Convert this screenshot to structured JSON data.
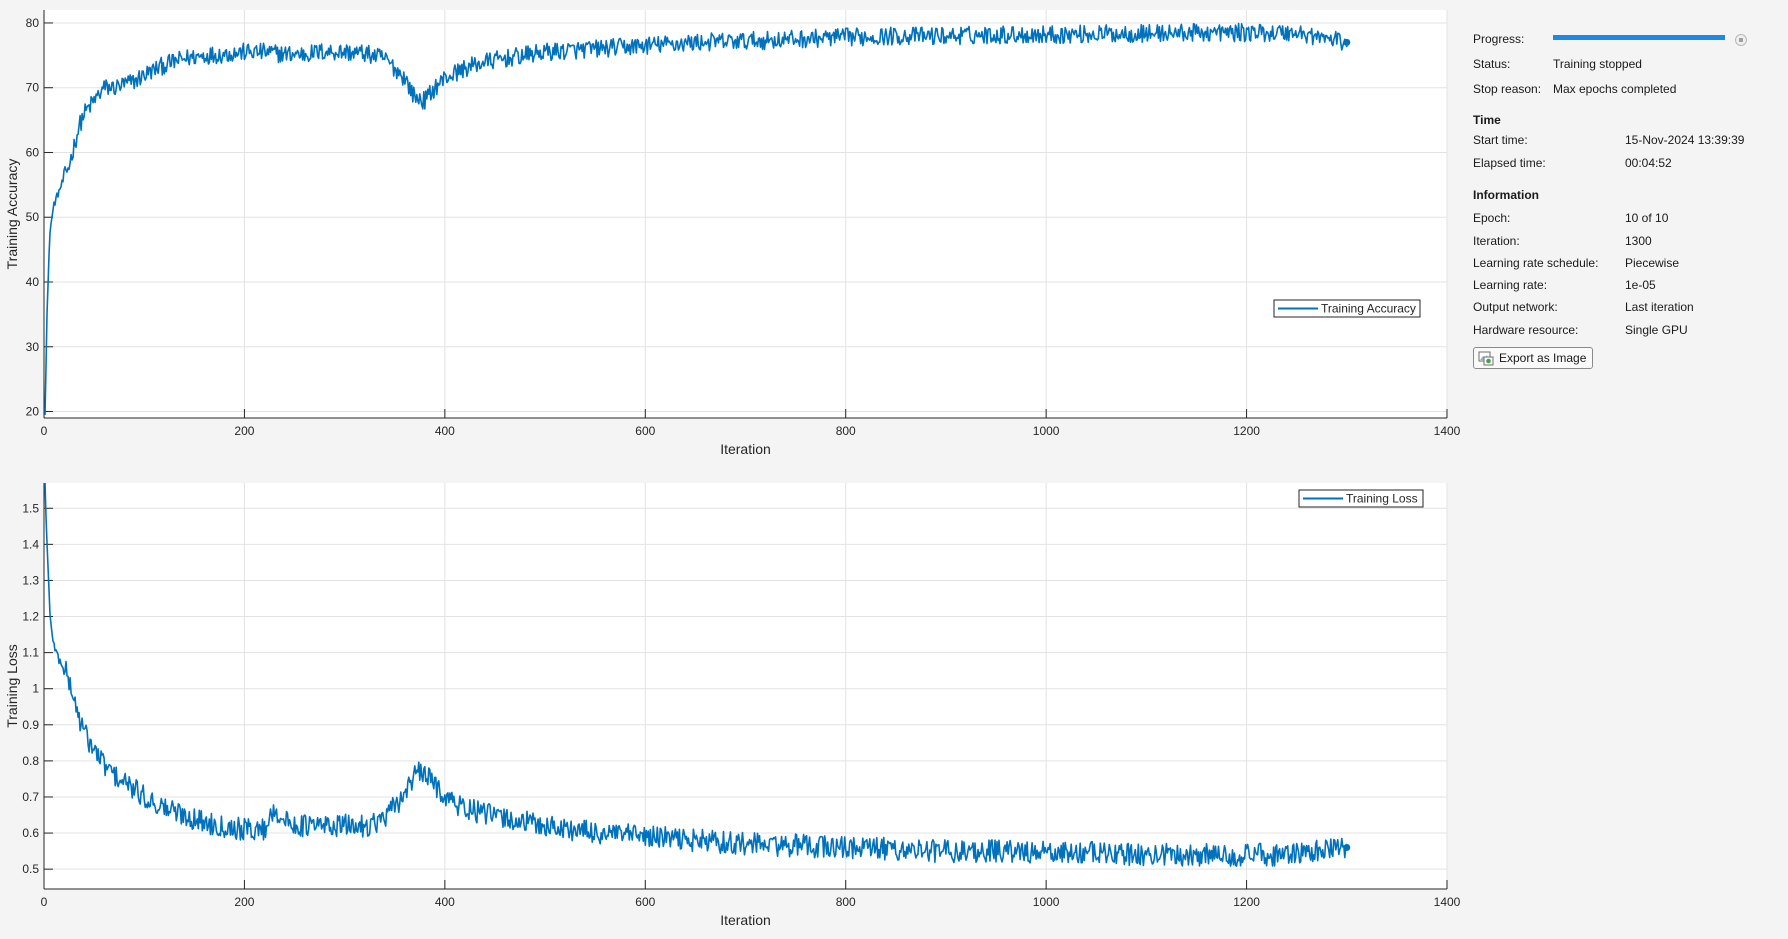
{
  "panel": {
    "progress_label": "Progress:",
    "progress_fraction": 1.0,
    "status_label": "Status:",
    "status_value": "Training stopped",
    "stop_reason_label": "Stop reason:",
    "stop_reason_value": "Max epochs completed",
    "time_heading": "Time",
    "start_time_label": "Start time:",
    "start_time_value": "15-Nov-2024 13:39:39",
    "elapsed_label": "Elapsed time:",
    "elapsed_value": "00:04:52",
    "info_heading": "Information",
    "epoch_label": "Epoch:",
    "epoch_value": "10 of 10",
    "iteration_label": "Iteration:",
    "iteration_value": "1300",
    "lr_schedule_label": "Learning rate schedule:",
    "lr_schedule_value": "Piecewise",
    "lr_label": "Learning rate:",
    "lr_value": "1e-05",
    "output_label": "Output network:",
    "output_value": "Last iteration",
    "hardware_label": "Hardware resource:",
    "hardware_value": "Single GPU",
    "export_label": "Export as Image",
    "accent_color": "#1e88e5"
  },
  "chart_data": [
    {
      "type": "line",
      "xlabel": "Iteration",
      "ylabel": "Training Accuracy",
      "xlim": [
        0,
        1400
      ],
      "ylim": [
        19,
        82
      ],
      "xticks": [
        0,
        200,
        400,
        600,
        800,
        1000,
        1200,
        1400
      ],
      "yticks": [
        20,
        30,
        40,
        50,
        60,
        70,
        80
      ],
      "grid": true,
      "legend_position": "right",
      "line_color": "#0072bd",
      "series": [
        {
          "name": "Training Accuracy",
          "x": [
            1,
            3,
            6,
            10,
            15,
            20,
            25,
            30,
            35,
            40,
            50,
            60,
            70,
            80,
            90,
            100,
            120,
            140,
            160,
            180,
            200,
            220,
            240,
            260,
            280,
            300,
            320,
            340,
            350,
            360,
            370,
            380,
            390,
            400,
            420,
            440,
            460,
            480,
            500,
            550,
            600,
            650,
            700,
            750,
            800,
            850,
            900,
            950,
            1000,
            1050,
            1100,
            1150,
            1200,
            1250,
            1300
          ],
          "y": [
            20,
            35,
            48,
            52,
            54,
            56,
            58,
            61,
            64,
            66,
            68,
            70,
            70,
            70.5,
            71,
            72,
            73.5,
            74.5,
            75,
            75.2,
            75.5,
            75.5,
            75.2,
            75.2,
            75.6,
            75.5,
            75.3,
            74.5,
            73,
            71.5,
            68.5,
            68,
            70,
            71.5,
            73,
            74,
            74.5,
            75,
            75.5,
            76,
            76.5,
            77,
            77.2,
            77.5,
            77.8,
            78,
            78,
            78.2,
            78.2,
            78.3,
            78.4,
            78.5,
            78.5,
            78.5,
            77
          ]
        }
      ]
    },
    {
      "type": "line",
      "xlabel": "Iteration",
      "ylabel": "Training Loss",
      "xlim": [
        0,
        1400
      ],
      "ylim": [
        0.445,
        1.57
      ],
      "xticks": [
        0,
        200,
        400,
        600,
        800,
        1000,
        1200,
        1400
      ],
      "yticks": [
        0.5,
        0.6,
        0.7,
        0.8,
        0.9,
        1,
        1.1,
        1.2,
        1.3,
        1.4,
        1.5
      ],
      "yticklabels": [
        "0.5",
        "0.6",
        "0.7",
        "0.8",
        "0.9",
        "1",
        "1.1",
        "1.2",
        "1.3",
        "1.4",
        "1.5"
      ],
      "grid": true,
      "legend_position": "top-right",
      "line_color": "#0072bd",
      "series": [
        {
          "name": "Training Loss",
          "x": [
            1,
            3,
            6,
            10,
            15,
            20,
            25,
            30,
            35,
            40,
            50,
            60,
            70,
            80,
            90,
            100,
            120,
            140,
            160,
            180,
            200,
            220,
            230,
            240,
            260,
            280,
            300,
            320,
            340,
            355,
            365,
            375,
            385,
            395,
            410,
            430,
            460,
            500,
            550,
            600,
            650,
            700,
            750,
            800,
            850,
            900,
            950,
            1000,
            1050,
            1100,
            1150,
            1200,
            1250,
            1300
          ],
          "y": [
            1.57,
            1.4,
            1.2,
            1.12,
            1.08,
            1.06,
            1.02,
            0.97,
            0.92,
            0.88,
            0.83,
            0.79,
            0.76,
            0.74,
            0.72,
            0.7,
            0.67,
            0.65,
            0.63,
            0.62,
            0.61,
            0.61,
            0.67,
            0.63,
            0.62,
            0.62,
            0.62,
            0.62,
            0.64,
            0.69,
            0.74,
            0.77,
            0.75,
            0.72,
            0.68,
            0.66,
            0.64,
            0.62,
            0.6,
            0.59,
            0.58,
            0.57,
            0.565,
            0.56,
            0.555,
            0.55,
            0.55,
            0.545,
            0.545,
            0.54,
            0.54,
            0.54,
            0.54,
            0.56
          ]
        }
      ]
    }
  ]
}
